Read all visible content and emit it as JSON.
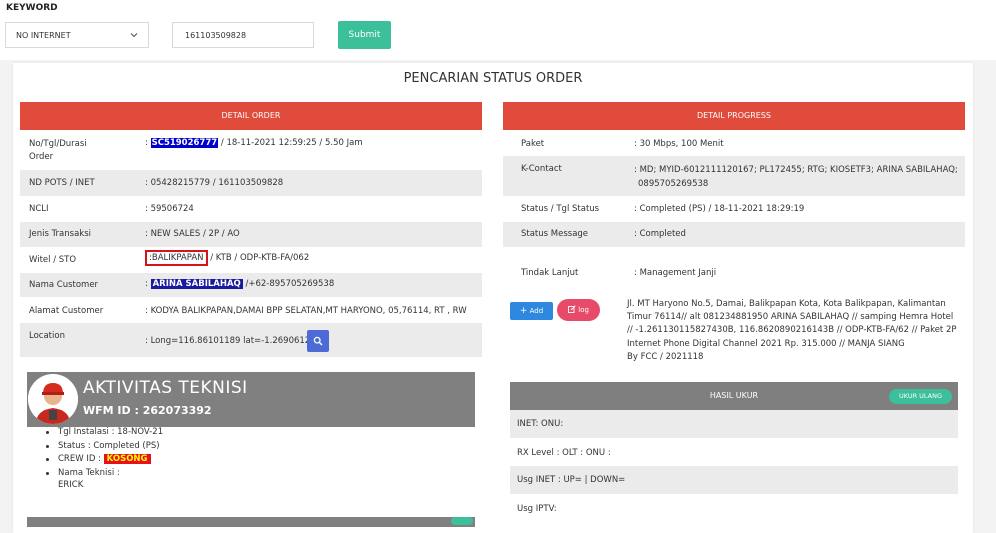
{
  "search": {
    "keyword_label": "KEYWORD",
    "type_selected": "NO INTERNET",
    "keyword_value": "161103509828",
    "submit_label": "Submit"
  },
  "page_title": "PENCARIAN STATUS ORDER",
  "detail_order": {
    "header": "DETAIL ORDER",
    "rows": [
      {
        "label_l1": "No/Tgl/Durasi",
        "label_l2": "Order",
        "sep": ":",
        "code": "SC519026777",
        "rest": " / 18-11-2021 12:59:25 / 5.50 Jam"
      },
      {
        "label": "ND POTS / INET",
        "value": ": 05428215779 / 161103509828"
      },
      {
        "label": "NCLI",
        "value": ": 59506724"
      },
      {
        "label": "Jenis Transaksi",
        "value": ": NEW SALES / 2P / AO"
      },
      {
        "label": "Witel / STO",
        "sep": ":",
        "witel": "BALIKPAPAN",
        "rest": " / KTB / ODP-KTB-FA/062"
      },
      {
        "label": "Nama Customer",
        "sep": ":",
        "name": "ARINA SABILAHAQ",
        "rest": " /+62-895705269538"
      },
      {
        "label": "Alamat Customer",
        "value": ": KODYA BALIKPAPAN,DAMAI BPP SELATAN,MT HARYONO, 05,76114, RT , RW"
      },
      {
        "label": "Location",
        "value": ": Long=116.86101189 lat=-1.26906128"
      }
    ]
  },
  "technician": {
    "title": "AKTIVITAS TEKNISI",
    "wfm_id": "WFM ID : 262073392",
    "items": [
      "Tgl Instalasi : 18-NOV-21",
      "Status : Completed (PS)",
      "CREW ID :",
      "Nama Teknisi :"
    ],
    "crew_badge": "KOSONG",
    "technician_name": "ERICK"
  },
  "detail_progress": {
    "header": "DETAIL PROGRESS",
    "rows": [
      {
        "label": "Paket",
        "value": ": 30 Mbps, 100 Menit"
      },
      {
        "label": "K-Contact",
        "value_l1": ": MD; MYID-6012111120167; PL172455; RTG; KIOSETF3; ARINA SABILAHAQ;",
        "value_l2": "0895705269538"
      },
      {
        "label": "Status / Tgl Status",
        "value": ": Completed (PS)   / 18-11-2021 18:29:19"
      },
      {
        "label": "Status Message",
        "value": ": Completed"
      },
      {
        "label": "Tindak Lanjut",
        "value": ": Management Janji"
      }
    ],
    "add_label": "Add",
    "log_label": "log",
    "note_lines": [
      "Jl. MT Haryono No.5, Damai, Balikpapan Kota, Kota Balikpapan, Kalimantan",
      "Timur 76114// alt 081234881950 ARINA SABILAHAQ // samping Hemra Hotel",
      "// -1.261130115827430B, 116.8620890216143B // ODP-KTB-FA/62 // Paket 2P",
      "Internet Phone Digital Channel 2021 Rp. 315.000 // MANJA SIANG",
      "By FCC / 2021118"
    ]
  },
  "hasil_ukur": {
    "header": "HASIL UKUR",
    "button": "UKUR ULANG",
    "rows": [
      "INET: ONU:",
      "RX Level : OLT : ONU :",
      "Usg INET : UP= | DOWN=",
      "Usg IPTV:"
    ]
  },
  "colors": {
    "red_header": "#e04b3b",
    "teal_button": "#3cbf9b",
    "gray_card": "#808080",
    "highlight_blue": "#0000cc"
  }
}
